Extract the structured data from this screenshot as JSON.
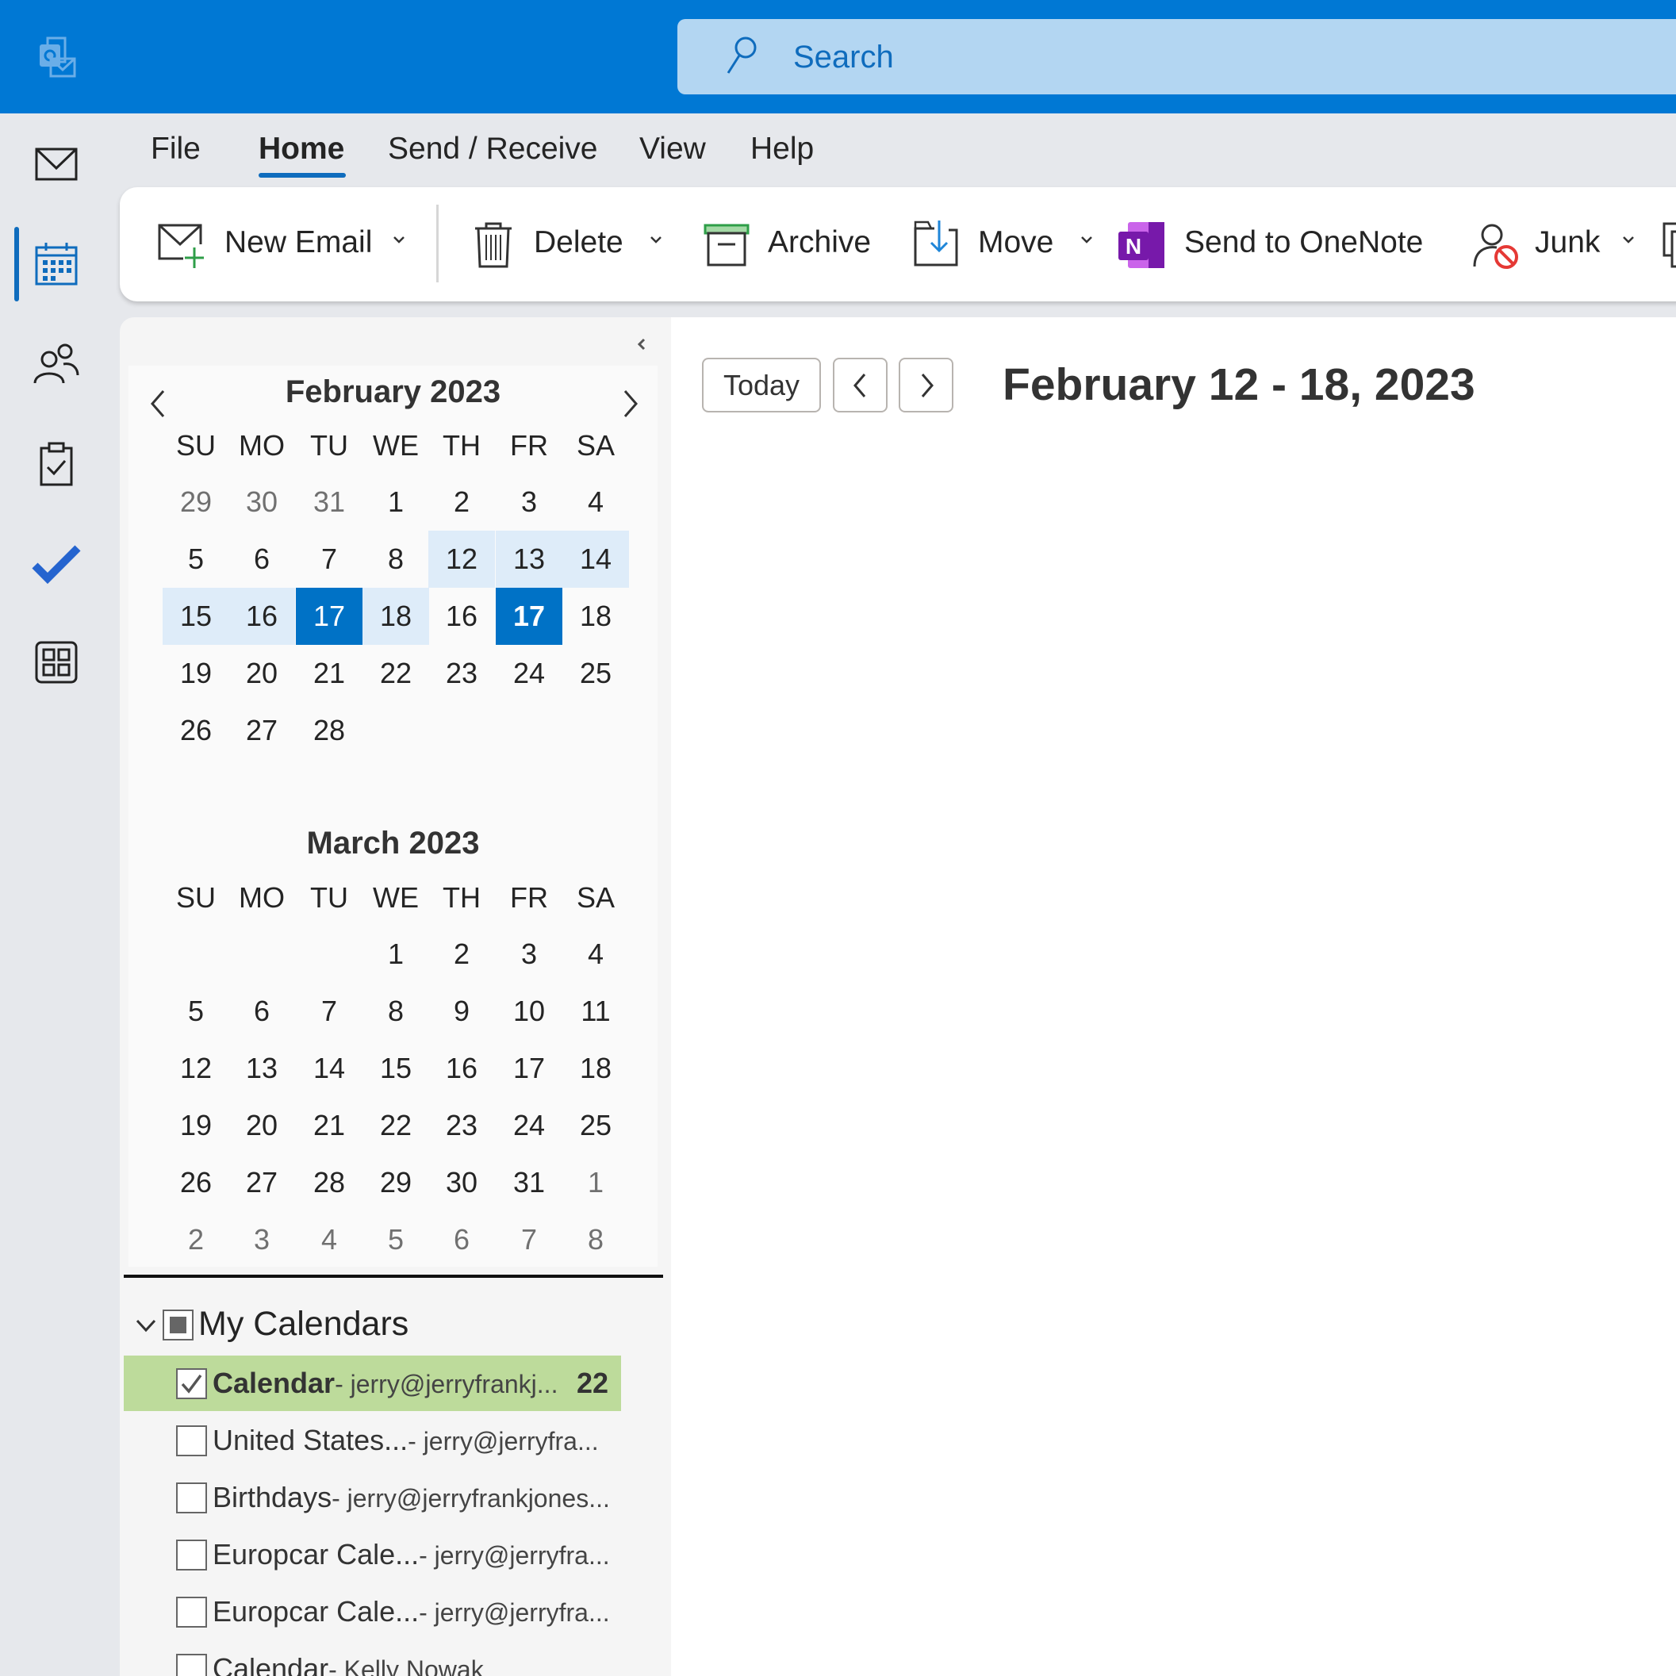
{
  "app": {
    "logo": "outlook-logo",
    "accent": "#0078d4"
  },
  "search": {
    "placeholder": "Search"
  },
  "rail": {
    "items": [
      "mail-icon",
      "calendar-icon",
      "people-icon",
      "tasks-icon",
      "todo-icon",
      "apps-icon"
    ],
    "active": "calendar-icon"
  },
  "menu": {
    "tabs": [
      "File",
      "Home",
      "Send / Receive",
      "View",
      "Help"
    ],
    "active": "Home"
  },
  "ribbon": {
    "new_email": "New Email",
    "delete": "Delete",
    "archive": "Archive",
    "move": "Move",
    "onenote": "Send to OneNote",
    "junk": "Junk"
  },
  "minical": [
    {
      "title": "February 2023",
      "dow": [
        "SU",
        "MO",
        "TU",
        "WE",
        "TH",
        "FR",
        "SA"
      ],
      "weeks": [
        [
          {
            "d": "29",
            "s": "other"
          },
          {
            "d": "30",
            "s": "other"
          },
          {
            "d": "31",
            "s": "other"
          },
          {
            "d": "1"
          },
          {
            "d": "2"
          },
          {
            "d": "3"
          },
          {
            "d": "4"
          }
        ],
        [
          {
            "d": "5"
          },
          {
            "d": "6"
          },
          {
            "d": "7"
          },
          {
            "d": "8"
          },
          {
            "d": "12",
            "s": "week"
          },
          {
            "d": "13",
            "s": "week"
          },
          {
            "d": "14",
            "s": "week"
          }
        ],
        [
          {
            "d": "15",
            "s": "week"
          },
          {
            "d": "16",
            "s": "week"
          },
          {
            "d": "17",
            "s": "selected"
          },
          {
            "d": "18",
            "s": "week"
          },
          {
            "d": "16"
          },
          {
            "d": "17",
            "s": "today"
          },
          {
            "d": "18"
          }
        ],
        [
          {
            "d": "19"
          },
          {
            "d": "20"
          },
          {
            "d": "21"
          },
          {
            "d": "22"
          },
          {
            "d": "23"
          },
          {
            "d": "24"
          },
          {
            "d": "25"
          }
        ],
        [
          {
            "d": "26"
          },
          {
            "d": "27"
          },
          {
            "d": "28"
          }
        ]
      ]
    },
    {
      "title": "March 2023",
      "dow": [
        "SU",
        "MO",
        "TU",
        "WE",
        "TH",
        "FR",
        "SA"
      ],
      "weeks": [
        [
          {
            "d": ""
          },
          {
            "d": ""
          },
          {
            "d": ""
          },
          {
            "d": "1"
          },
          {
            "d": "2"
          },
          {
            "d": "3"
          },
          {
            "d": "4"
          }
        ],
        [
          {
            "d": "5"
          },
          {
            "d": "6"
          },
          {
            "d": "7"
          },
          {
            "d": "8"
          },
          {
            "d": "9"
          },
          {
            "d": "10"
          },
          {
            "d": "11"
          }
        ],
        [
          {
            "d": "12"
          },
          {
            "d": "13"
          },
          {
            "d": "14"
          },
          {
            "d": "15"
          },
          {
            "d": "16"
          },
          {
            "d": "17"
          },
          {
            "d": "18"
          }
        ],
        [
          {
            "d": "19"
          },
          {
            "d": "20"
          },
          {
            "d": "21"
          },
          {
            "d": "22"
          },
          {
            "d": "23"
          },
          {
            "d": "24"
          },
          {
            "d": "25"
          }
        ],
        [
          {
            "d": "26"
          },
          {
            "d": "27"
          },
          {
            "d": "28"
          },
          {
            "d": "29"
          },
          {
            "d": "30"
          },
          {
            "d": "31"
          },
          {
            "d": "1",
            "s": "other"
          }
        ],
        [
          {
            "d": "2",
            "s": "other"
          },
          {
            "d": "3",
            "s": "other"
          },
          {
            "d": "4",
            "s": "other"
          },
          {
            "d": "5",
            "s": "other"
          },
          {
            "d": "6",
            "s": "other"
          },
          {
            "d": "7",
            "s": "other"
          },
          {
            "d": "8",
            "s": "other"
          }
        ]
      ]
    }
  ],
  "calendars": {
    "group": "My Calendars",
    "items": [
      {
        "name": "Calendar",
        "owner": "- jerry@jerryfrankj...",
        "count": "22",
        "checked": true,
        "color": "#bddb9b"
      },
      {
        "name": "United States...",
        "owner": "- jerry@jerryfra...",
        "checked": false
      },
      {
        "name": "Birthdays",
        "owner": "- jerry@jerryfrankjones...",
        "checked": false
      },
      {
        "name": "Europcar Cale...",
        "owner": "- jerry@jerryfra...",
        "checked": false
      },
      {
        "name": "Europcar Cale...",
        "owner": "- jerry@jerryfra...",
        "checked": false
      },
      {
        "name": "Calendar",
        "owner": "- Kelly Nowak",
        "checked": false
      }
    ]
  },
  "main": {
    "today": "Today",
    "range": "February 12 - 18, 2023"
  }
}
